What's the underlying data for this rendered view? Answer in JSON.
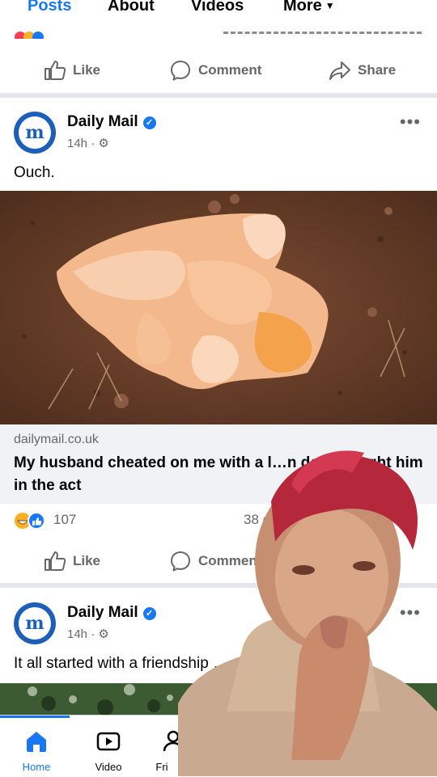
{
  "tabs": [
    {
      "label": "Posts",
      "active": true
    },
    {
      "label": "About"
    },
    {
      "label": "Videos"
    },
    {
      "label": "More"
    }
  ],
  "actions": {
    "like": "Like",
    "comment": "Comment",
    "share": "Share"
  },
  "posts": [
    {
      "page_name": "Daily Mail",
      "avatar_letter": "m",
      "time": "14h",
      "caption": "Ouch.",
      "link_domain": "dailymail.co.uk",
      "link_title": "My husband cheated on me with a l…n doll I caught him in the act",
      "reaction_count": "107",
      "comment_count": "38 c"
    },
    {
      "page_name": "Daily Mail",
      "avatar_letter": "m",
      "time": "14h",
      "caption": "It all started with a friendship …"
    }
  ],
  "bottom_nav": [
    {
      "label": "Home",
      "icon": "home-icon",
      "active": true
    },
    {
      "label": "Video",
      "icon": "video-icon"
    },
    {
      "label": "Fri",
      "icon": "friends-icon"
    }
  ],
  "colors": {
    "accent": "#1877f2",
    "secondary_text": "#65676b",
    "divider": "#e4e6eb",
    "link_bg": "#f0f2f5"
  }
}
